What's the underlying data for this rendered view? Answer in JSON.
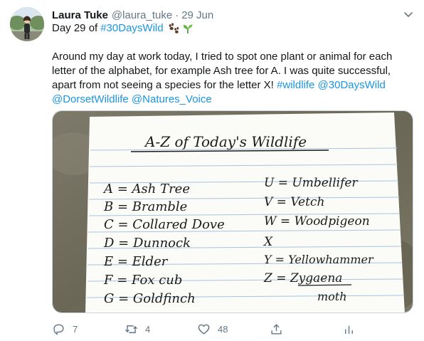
{
  "tweet": {
    "author_name": "Laura Tuke",
    "handle": "@laura_tuke",
    "separator": "·",
    "date": "29 Jun",
    "line2_prefix": "Day 29 of",
    "line2_hashtag": "#30DaysWild",
    "body_plain": "Around my day at work today, I tried to spot one plant or animal for each letter of the alphabet, for example Ash tree for A. I was quite successful, apart from not seeing a species for the letter X!",
    "body_tag_wildlife": "#wildlife",
    "body_tag_30dayswild": "@30DaysWild",
    "body_tag_dorset": "@DorsetWildlife",
    "body_tag_natures": "@Natures_Voice"
  },
  "photo": {
    "title": "A-Z of Today's Wildlife",
    "left_entries": [
      "A = Ash Tree",
      "B = Bramble",
      "C = Collared Dove",
      "D = Dunnock",
      "E = Elder",
      "F = Fox cub",
      "G = Goldfinch"
    ],
    "right_entries": [
      "U = Umbellifer",
      "V = Vetch",
      "W = Woodpigeon",
      "X",
      "Y = Yellowhammer",
      "Z = Zygaena",
      "moth"
    ]
  },
  "actions": {
    "replies": "7",
    "retweets": "4",
    "likes": "48"
  },
  "colors": {
    "link": "#1b95e0",
    "muted": "#657786",
    "text": "#14171a"
  },
  "icons": [
    "paw-prints-icon",
    "seedling-icon",
    "chevron-down-icon",
    "reply-icon",
    "retweet-icon",
    "like-icon",
    "share-icon",
    "analytics-icon"
  ]
}
